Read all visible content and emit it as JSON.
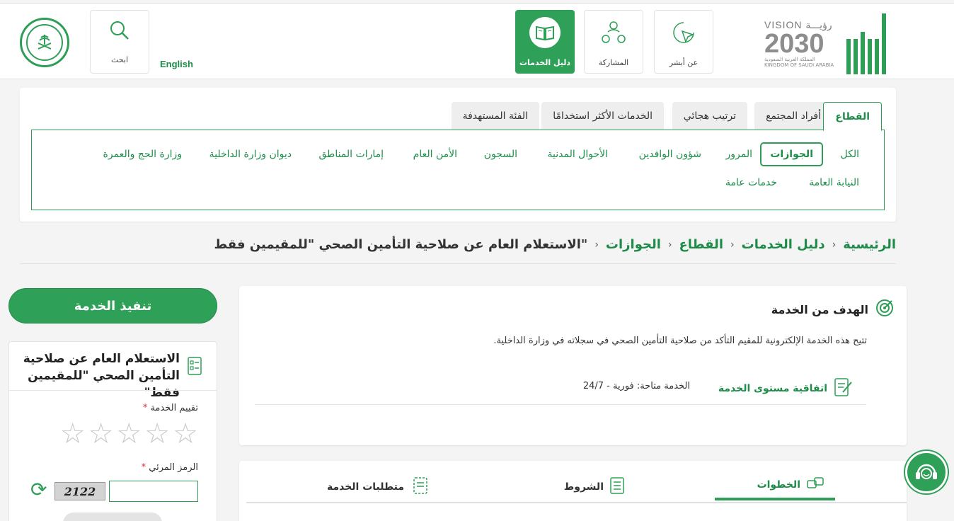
{
  "header": {
    "search_label": "ابحث",
    "lang_link": "English",
    "nav": [
      {
        "label": "دليل الخدمات",
        "icon": "book-icon",
        "active": true
      },
      {
        "label": "المشاركة",
        "icon": "participation-icon",
        "active": false
      },
      {
        "label": "عن أبشر",
        "icon": "cursor-icon",
        "active": false
      }
    ],
    "vision": {
      "top": "VISION رؤيـــة",
      "year": "2030",
      "sub_ar": "المملكة العربية السعودية",
      "sub_en": "KINGDOM OF SAUDI ARABIA"
    },
    "brand_color": "#2ea057"
  },
  "filters": {
    "tabs": [
      "القطاع",
      "أفراد المجتمع",
      "ترتيب هجائي",
      "الخدمات الأكثر استخدامًا",
      "الفئة المستهدفة"
    ],
    "active_tab": "القطاع",
    "chips_row1": [
      "الكل",
      "الجوازات",
      "المرور",
      "شؤون الوافدين",
      "الأحوال المدنية",
      "السجون",
      "الأمن العام",
      "إمارات المناطق",
      "ديوان وزارة الداخلية",
      "وزارة الحج والعمرة"
    ],
    "chips_row2": [
      "النيابة العامة",
      "خدمات عامة"
    ],
    "active_chip": "الجوازات"
  },
  "breadcrumb": {
    "items": [
      "الرئيسية",
      "دليل الخدمات",
      "القطاع",
      "الجوازات"
    ],
    "current": "الاستعلام العام عن صلاحية التأمين الصحي \"للمقيمين فقط\"",
    "sep": "›"
  },
  "goal": {
    "title": "الهدف من الخدمة",
    "text": "تتيح هذه الخدمة الإلكترونية للمقيم التأكد من صلاحية التأمين الصحي في سجلاته في وزارة الداخلية.",
    "sla_label": "اتفاقية مستوى الخدمة",
    "availability": "الخدمة متاحة: فورية - 24/7"
  },
  "service_tabs": {
    "steps": "الخطوات",
    "conditions": "الشروط",
    "requirements": "متطلبات الخدمة",
    "active": "الخطوات"
  },
  "sidebar": {
    "execute_label": "تنفيذ الخدمة",
    "service_title": "الاستعلام العام عن صلاحية التأمين الصحي \"للمقيمين فقط\"",
    "rating_label": "تقييم الخدمة",
    "required_mark": "*",
    "stars": [
      "☆",
      "☆",
      "☆",
      "☆",
      "☆"
    ],
    "stars_filled": 0,
    "code_label": "الرمز المرئي",
    "code_value": "",
    "captcha_text": "2122"
  }
}
